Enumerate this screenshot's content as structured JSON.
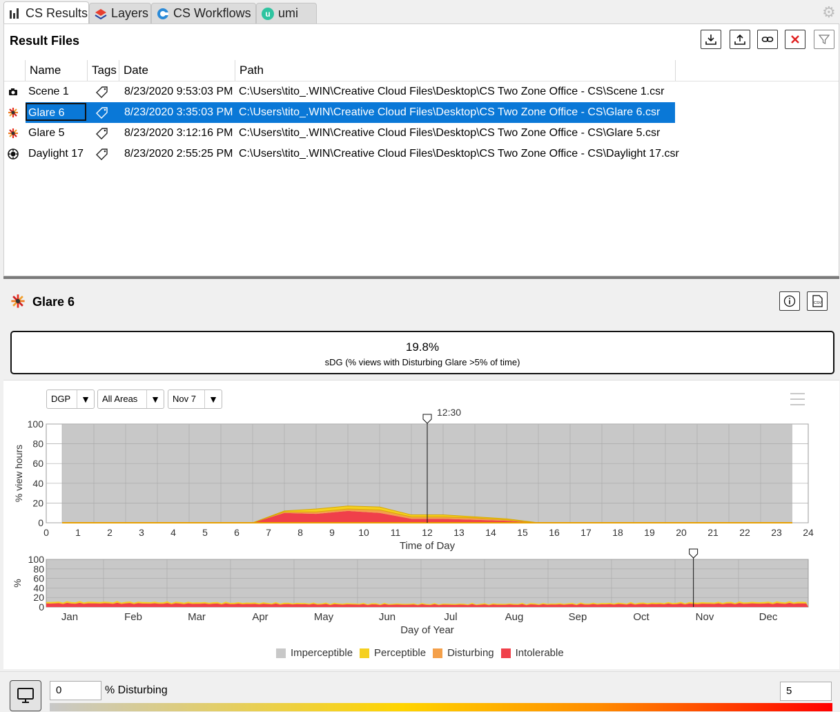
{
  "tabs": [
    {
      "label": "CS Results",
      "icon": "bar-chart-icon",
      "active": true
    },
    {
      "label": "Layers",
      "icon": "layers-icon",
      "active": false
    },
    {
      "label": "CS Workflows",
      "icon": "workflows-icon",
      "active": false
    },
    {
      "label": "umi",
      "icon": "umi-icon",
      "active": false
    }
  ],
  "result_files": {
    "title": "Result Files",
    "toolbar": [
      "download-icon",
      "upload-icon",
      "link-icon",
      "delete-icon",
      "filter-icon"
    ],
    "columns": [
      "Name",
      "Tags",
      "Date",
      "Path"
    ],
    "rows": [
      {
        "icon": "camera-icon",
        "name": "Scene 1",
        "date": "8/23/2020 9:53:03 PM",
        "path": "C:\\Users\\tito_.WIN\\Creative Cloud Files\\Desktop\\CS Two Zone Office - CS\\Scene 1.csr",
        "selected": false
      },
      {
        "icon": "glare-icon",
        "name": "Glare 6",
        "date": "8/23/2020 3:35:03 PM",
        "path": "C:\\Users\\tito_.WIN\\Creative Cloud Files\\Desktop\\CS Two Zone Office - CS\\Glare 6.csr",
        "selected": true
      },
      {
        "icon": "glare-icon",
        "name": "Glare 5",
        "date": "8/23/2020 3:12:16 PM",
        "path": "C:\\Users\\tito_.WIN\\Creative Cloud Files\\Desktop\\CS Two Zone Office - CS\\Glare 5.csr",
        "selected": false
      },
      {
        "icon": "daylight-icon",
        "name": "Daylight 17",
        "date": "8/23/2020 2:55:25 PM",
        "path": "C:\\Users\\tito_.WIN\\Creative Cloud Files\\Desktop\\CS Two Zone Office - CS\\Daylight 17.csr",
        "selected": false
      }
    ]
  },
  "detail": {
    "title": "Glare 6",
    "metric_value": "19.8%",
    "metric_label": "sDG (% views with Disturbing Glare >5% of time)",
    "dropdowns": [
      "DGP",
      "All Areas",
      "Nov 7"
    ],
    "marker_label": "12:30"
  },
  "colors": {
    "imperceptible": "#c8c8c8",
    "perceptible": "#f5d020",
    "disturbing": "#f4a04a",
    "intolerable": "#f0404a",
    "selection": "#0a78d7"
  },
  "chart_data": [
    {
      "type": "area",
      "xlabel": "Time of Day",
      "ylabel": "% view hours",
      "xlim": [
        0,
        24
      ],
      "ylim": [
        0,
        100
      ],
      "x_ticks": [
        0,
        1,
        2,
        3,
        4,
        5,
        6,
        7,
        8,
        9,
        10,
        11,
        12,
        13,
        14,
        15,
        16,
        17,
        18,
        19,
        20,
        21,
        22,
        23,
        24
      ],
      "y_ticks": [
        0,
        20,
        40,
        60,
        80,
        100
      ],
      "x": [
        0.5,
        6.5,
        7.5,
        8.5,
        9.5,
        10.5,
        11.5,
        12.5,
        13.5,
        14.5,
        15.5,
        23.5
      ],
      "series": [
        {
          "name": "Intolerable",
          "values": [
            0,
            0,
            10,
            9,
            12,
            10,
            4,
            4,
            3,
            2,
            0,
            0
          ]
        },
        {
          "name": "Disturbing",
          "values": [
            0,
            0,
            1,
            2,
            2,
            3,
            2,
            2,
            2,
            1,
            0,
            0
          ]
        },
        {
          "name": "Perceptible",
          "values": [
            0,
            0,
            1,
            3,
            3,
            3,
            2,
            2,
            1,
            1,
            0,
            0
          ]
        },
        {
          "name": "Imperceptible",
          "values": [
            100,
            100,
            88,
            86,
            83,
            84,
            92,
            92,
            94,
            96,
            100,
            100
          ]
        }
      ],
      "marker_x": 12.5
    },
    {
      "type": "area",
      "xlabel": "Day of Year",
      "ylabel": "%",
      "ylim": [
        0,
        100
      ],
      "y_ticks": [
        0,
        20,
        40,
        60,
        80,
        100
      ],
      "categories": [
        "Jan",
        "Feb",
        "Mar",
        "Apr",
        "May",
        "Jun",
        "Jul",
        "Aug",
        "Sep",
        "Oct",
        "Nov",
        "Dec"
      ],
      "series_note_values_percent_range": [
        0,
        15
      ],
      "marker_day": 311
    }
  ],
  "legend": [
    "Imperceptible",
    "Perceptible",
    "Disturbing",
    "Intolerable"
  ],
  "bottom": {
    "min_value": "0",
    "label": "% Disturbing",
    "max_value": "5"
  }
}
